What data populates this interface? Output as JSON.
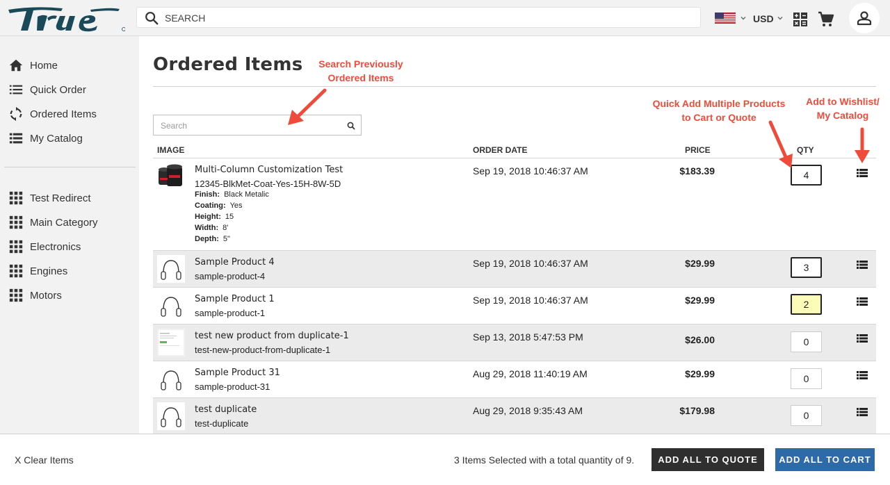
{
  "header": {
    "brand": "true",
    "search_placeholder": "SEARCH",
    "currency": "USD"
  },
  "sidebar": {
    "primary": [
      {
        "label": "Home",
        "icon": "home-icon"
      },
      {
        "label": "Quick Order",
        "icon": "list-icon"
      },
      {
        "label": "Ordered Items",
        "icon": "refresh-icon"
      },
      {
        "label": "My Catalog",
        "icon": "catalog-icon"
      }
    ],
    "categories": [
      {
        "label": "Test Redirect",
        "icon": "grid-icon"
      },
      {
        "label": "Main Category",
        "icon": "grid-icon"
      },
      {
        "label": "Electronics",
        "icon": "grid-icon"
      },
      {
        "label": "Engines",
        "icon": "grid-icon"
      },
      {
        "label": "Motors",
        "icon": "grid-icon"
      }
    ]
  },
  "page": {
    "title": "Ordered Items",
    "search_placeholder": "Search"
  },
  "table": {
    "columns": {
      "image": "IMAGE",
      "date": "ORDER DATE",
      "price": "PRICE",
      "qty": "QTY"
    },
    "rows": [
      {
        "name": "Multi-Column Customization Test",
        "sku": "12345-BlkMet-Coat-Yes-15H-8W-5D",
        "attributes": [
          {
            "label": "Finish:",
            "value": "Black Metalic"
          },
          {
            "label": "Coating:",
            "value": "Yes"
          },
          {
            "label": "Height:",
            "value": "15"
          },
          {
            "label": "Width:",
            "value": "8'"
          },
          {
            "label": "Depth:",
            "value": "5\""
          }
        ],
        "date": "Sep 19, 2018 10:46:37 AM",
        "price": "$183.39",
        "qty": "4"
      },
      {
        "name": "Sample Product 4",
        "sku": "sample-product-4",
        "date": "Sep 19, 2018 10:46:37 AM",
        "price": "$29.99",
        "qty": "3"
      },
      {
        "name": "Sample Product 1",
        "sku": "sample-product-1",
        "date": "Sep 19, 2018 10:46:37 AM",
        "price": "$29.99",
        "qty": "2"
      },
      {
        "name": "test new product from duplicate-1",
        "sku": "test-new-product-from-duplicate-1",
        "date": "Sep 13, 2018 5:47:53 PM",
        "price": "$26.00",
        "qty": "0"
      },
      {
        "name": "Sample Product 31",
        "sku": "sample-product-31",
        "date": "Aug 29, 2018 11:40:19 AM",
        "price": "$29.99",
        "qty": "0"
      },
      {
        "name": "test duplicate",
        "sku": "test-duplicate",
        "date": "Aug 29, 2018 9:35:43 AM",
        "price": "$179.98",
        "qty": "0"
      }
    ]
  },
  "annotations": {
    "search": [
      "Search Previously",
      "Ordered Items"
    ],
    "quick_add": [
      "Quick Add Multiple Products",
      "to Cart or Quote"
    ],
    "wishlist": [
      "Add to Wishlist/",
      "My Catalog"
    ],
    "color": "#ef4b3a"
  },
  "footer": {
    "clear": "X Clear Items",
    "summary": "3 Items Selected with a total quantity of 9.",
    "quote_button": "ADD ALL TO QUOTE",
    "cart_button": "ADD ALL TO CART"
  },
  "colors": {
    "brand": "#1a4a5a",
    "cart_button": "#2e69a8",
    "quote_button": "#2f2f2f",
    "highlight": "#fafcb7"
  }
}
